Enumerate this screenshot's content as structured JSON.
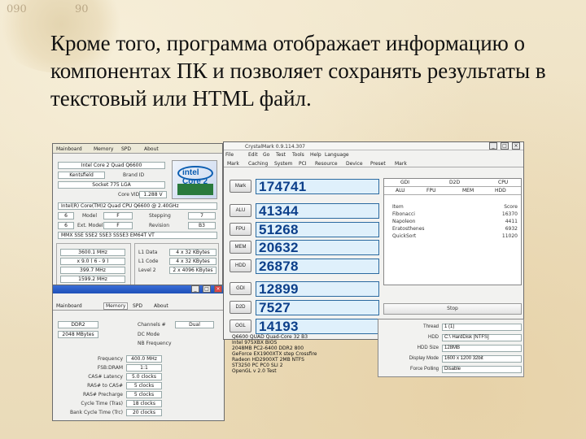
{
  "slide": {
    "bg_compass_numbers": [
      "090",
      "90"
    ],
    "title": "Кроме того, программа отображает информацию о компонентах ПК и позволяет сохранять результаты в текстовый или HTML файл."
  },
  "cpuz_cpu": {
    "tabs": [
      "Mainboard",
      "Memory",
      "SPD",
      "About"
    ],
    "name_value": "Intel Core 2 Quad Q6600",
    "codename": "Kentsfield",
    "brand_id_label": "Brand ID",
    "package": "Socket 775 LGA",
    "voltage_label": "Core VID",
    "voltage_value": "1.288 V",
    "specification": "Intel(R) Core(TM)2 Quad CPU Q6600 @ 2.40GHz",
    "family_label": "Family",
    "family_value": "6",
    "model_label": "Model",
    "model_value": "F",
    "stepping_label": "Stepping",
    "stepping_value": "7",
    "ext_family_value": "6",
    "ext_model_label": "Ext. Model",
    "ext_model_value": "F",
    "revision_label": "Revision",
    "revision_value": "B3",
    "instructions": "MMX SSE SSE2 SSE3 SSSE3 EM64T VT",
    "core_speed": "3600.1 MHz",
    "multiplier": "x 9.0 ( 6 - 9 )",
    "bus_speed": "399.7 MHz",
    "rated_fsb": "1599.2 MHz",
    "l1_data_label": "L1 Data",
    "l1_data_value": "4 x 32 KBytes",
    "l1_code_label": "L1 Code",
    "l1_code_value": "4 x 32 KBytes",
    "level2_label": "Level 2",
    "level2_value": "2 x 4096 KBytes",
    "brand_logo": "intel Core 2"
  },
  "cpuz_memory": {
    "tabs": [
      "Mainboard",
      "Memory",
      "SPD",
      "About"
    ],
    "type": "DDR2",
    "size": "2048 MBytes",
    "channels_label": "Channels #",
    "channels_value": "Dual",
    "dc_mode_label": "DC Mode",
    "nb_freq_label": "NB Frequency",
    "timing_rows": [
      {
        "label": "Frequency",
        "value": "400.0 MHz"
      },
      {
        "label": "FSB:DRAM",
        "value": "1:1"
      },
      {
        "label": "CAS# Latency",
        "value": "5.0 clocks"
      },
      {
        "label": "RAS# to CAS#",
        "value": "5 clocks"
      },
      {
        "label": "RAS# Precharge",
        "value": "5 clocks"
      },
      {
        "label": "Cycle Time (Tras)",
        "value": "18 clocks"
      },
      {
        "label": "Bank Cycle Time (Trc)",
        "value": "20 clocks"
      }
    ]
  },
  "crystalmark": {
    "window_title": "CrystalMark 0.9.114.307",
    "menu": [
      "File",
      "Edit",
      "Go",
      "Test",
      "Tools",
      "Help",
      "Language"
    ],
    "top_tabs": [
      "Mark",
      "Caching",
      "System",
      "PCI",
      "Resource",
      "Device",
      "Preset",
      "Mark"
    ],
    "bench_buttons": [
      "Mark",
      "ALU",
      "FPU",
      "MEM",
      "HDD",
      "GDI",
      "D2D",
      "OGL"
    ],
    "scores": [
      "174741",
      "41344",
      "51268",
      "20632",
      "26878",
      "12899",
      "7527",
      "14193"
    ],
    "side_tabs_top": [
      "GDI",
      "D2D",
      "CPU"
    ],
    "side_tabs": [
      "ALU",
      "FPU",
      "MEM",
      "HDD"
    ],
    "info_rows": [
      {
        "label": "Item",
        "value": "Score"
      },
      {
        "label": "Fibonacci",
        "value": "16370"
      },
      {
        "label": "Napoleon",
        "value": "4411"
      },
      {
        "label": "Eratosthenes",
        "value": "6932"
      },
      {
        "label": "QuickSort",
        "value": "11020"
      }
    ],
    "stop_label": "Stop",
    "settings": [
      {
        "label": "Thread",
        "value": "1 (1)"
      },
      {
        "label": "HDD",
        "value": "C:\\ HardDisk [NTFS]"
      },
      {
        "label": "HDD Size",
        "value": "128MB"
      },
      {
        "label": "Display Mode",
        "value": "1600 x 1200 32bit"
      },
      {
        "label": "Force Polling",
        "value": "Disable"
      }
    ],
    "system_lines": [
      "Q6600 QUAD Quad-Core 32 B3",
      "Intel 975XBX BIOS",
      "2048MB PC2-6400 DDR2 800",
      "GeForce EX1900XTX step Crossfire",
      "Radeon HD2900XT 2MB NTFS",
      "ST3250 PC PC0 SLI 2",
      "OpenGL v 2.0 Test"
    ]
  }
}
